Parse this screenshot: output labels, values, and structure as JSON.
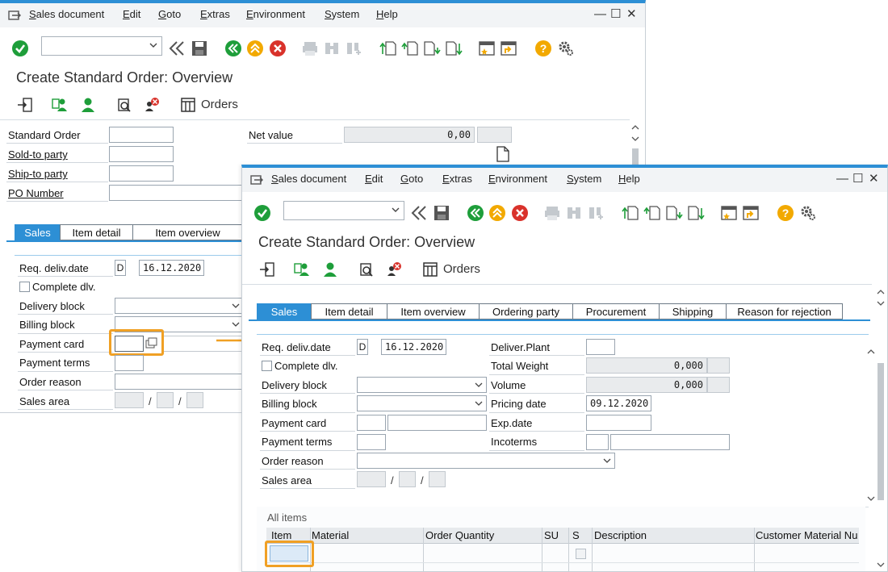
{
  "menu": {
    "items": [
      "Sales document",
      "Edit",
      "Goto",
      "Extras",
      "Environment",
      "System",
      "Help"
    ]
  },
  "window_controls": {
    "minimize": "—",
    "maximize": "☐",
    "close": "✕"
  },
  "title": "Create Standard Order: Overview",
  "app_toolbar": {
    "orders_label": "Orders"
  },
  "header": {
    "standard_order_label": "Standard Order",
    "sold_to_label": "Sold-to party",
    "ship_to_label": "Ship-to party",
    "po_number_label": "PO Number",
    "net_value_label": "Net value",
    "net_value": "0,00"
  },
  "tabs": {
    "sales": "Sales",
    "item_detail": "Item detail",
    "item_overview": "Item overview",
    "ordering_party": "Ordering party",
    "procurement": "Procurement",
    "shipping": "Shipping",
    "reason_for_rejection": "Reason for rejection"
  },
  "sales_tab": {
    "req_deliv_date_label": "Req. deliv.date",
    "req_deliv_date_type": "D",
    "req_deliv_date": "16.12.2020",
    "complete_dlv_label": "Complete dlv.",
    "delivery_block_label": "Delivery block",
    "billing_block_label": "Billing block",
    "payment_card_label": "Payment card",
    "payment_terms_label": "Payment terms",
    "order_reason_label": "Order reason",
    "sales_area_label": "Sales area",
    "sales_area_sep": "/",
    "deliver_plant_label": "Deliver.Plant",
    "total_weight_label": "Total Weight",
    "total_weight": "0,000",
    "volume_label": "Volume",
    "volume": "0,000",
    "pricing_date_label": "Pricing date",
    "pricing_date": "09.12.2020",
    "exp_date_label": "Exp.date",
    "incoterms_label": "Incoterms"
  },
  "items": {
    "section_label": "All items",
    "columns": [
      "Item",
      "Material",
      "Order Quantity",
      "SU",
      "S",
      "Description",
      "Customer Material Nu"
    ]
  },
  "colors": {
    "accent": "#2d8fd5",
    "highlight": "#f0a024",
    "green_icon": "#1e9e3a",
    "red_icon": "#d9322b",
    "yellow_icon": "#f2a900"
  }
}
